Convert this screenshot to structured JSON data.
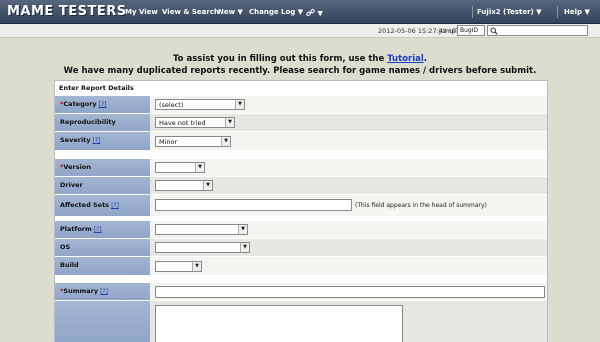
{
  "nav": {
    "logo": "MAME TESTERS",
    "my_view": "My View",
    "view_search": "View & Search",
    "new": "New ▼",
    "changelog": "Change Log ▼",
    "link": "▼",
    "user": "Fujix2 (Tester) ▼",
    "help": "Help ▼"
  },
  "subbar": {
    "timestamp": "2012-05-06 15:27:49 UTC",
    "jump_label": "Jump",
    "jump_value": "BugID",
    "search_value": ""
  },
  "instructions": {
    "line1_prefix": "To assist you in filling out this form, use the ",
    "line1_link": "Tutorial",
    "line1_suffix": ".",
    "line2": "We have many duplicated reports recently. Please search for game names / drivers before submit."
  },
  "form": {
    "header": "Enter Report Details",
    "help_mark": "[?]",
    "required_mark": "*",
    "category": {
      "label": "Category",
      "value": "(select)"
    },
    "reproducibility": {
      "label": "Reproducibility",
      "value": "Have not tried"
    },
    "severity": {
      "label": "Severity",
      "value": "Minor"
    },
    "version": {
      "label": "Version",
      "value": ""
    },
    "driver": {
      "label": "Driver",
      "value": ""
    },
    "affected_sets": {
      "label": "Affected Sets",
      "value": "",
      "note": "(This field appears in the head of summary)"
    },
    "platform": {
      "label": "Platform",
      "value": ""
    },
    "os": {
      "label": "OS",
      "value": ""
    },
    "build": {
      "label": "Build",
      "value": ""
    },
    "summary": {
      "label": "Summary",
      "value": ""
    },
    "description": {
      "label": "",
      "value": ""
    }
  }
}
